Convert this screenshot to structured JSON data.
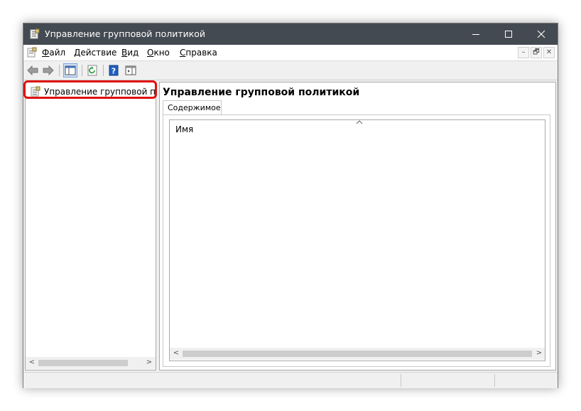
{
  "window": {
    "title": "Управление групповой политикой"
  },
  "menu": {
    "items": [
      {
        "label": "Файл"
      },
      {
        "label": "Действие"
      },
      {
        "label": "Вид"
      },
      {
        "label": "Окно"
      },
      {
        "label": "Справка"
      }
    ]
  },
  "mdi": {
    "minimize": "–",
    "restore": "🗗",
    "close": "✕"
  },
  "tree": {
    "root_label": "Управление групповой поли"
  },
  "panel": {
    "title": "Управление групповой политикой",
    "tab_label": "Содержимое",
    "column_name": "Имя"
  },
  "icons": {
    "app": "gpm-icon",
    "back": "back-arrow-icon",
    "forward": "forward-arrow-icon",
    "show_tree": "show-hide-tree-icon",
    "refresh": "refresh-icon",
    "help": "help-icon",
    "action_pane": "action-pane-icon"
  },
  "colors": {
    "titlebar": "#444a52",
    "highlight": "#e01010"
  }
}
